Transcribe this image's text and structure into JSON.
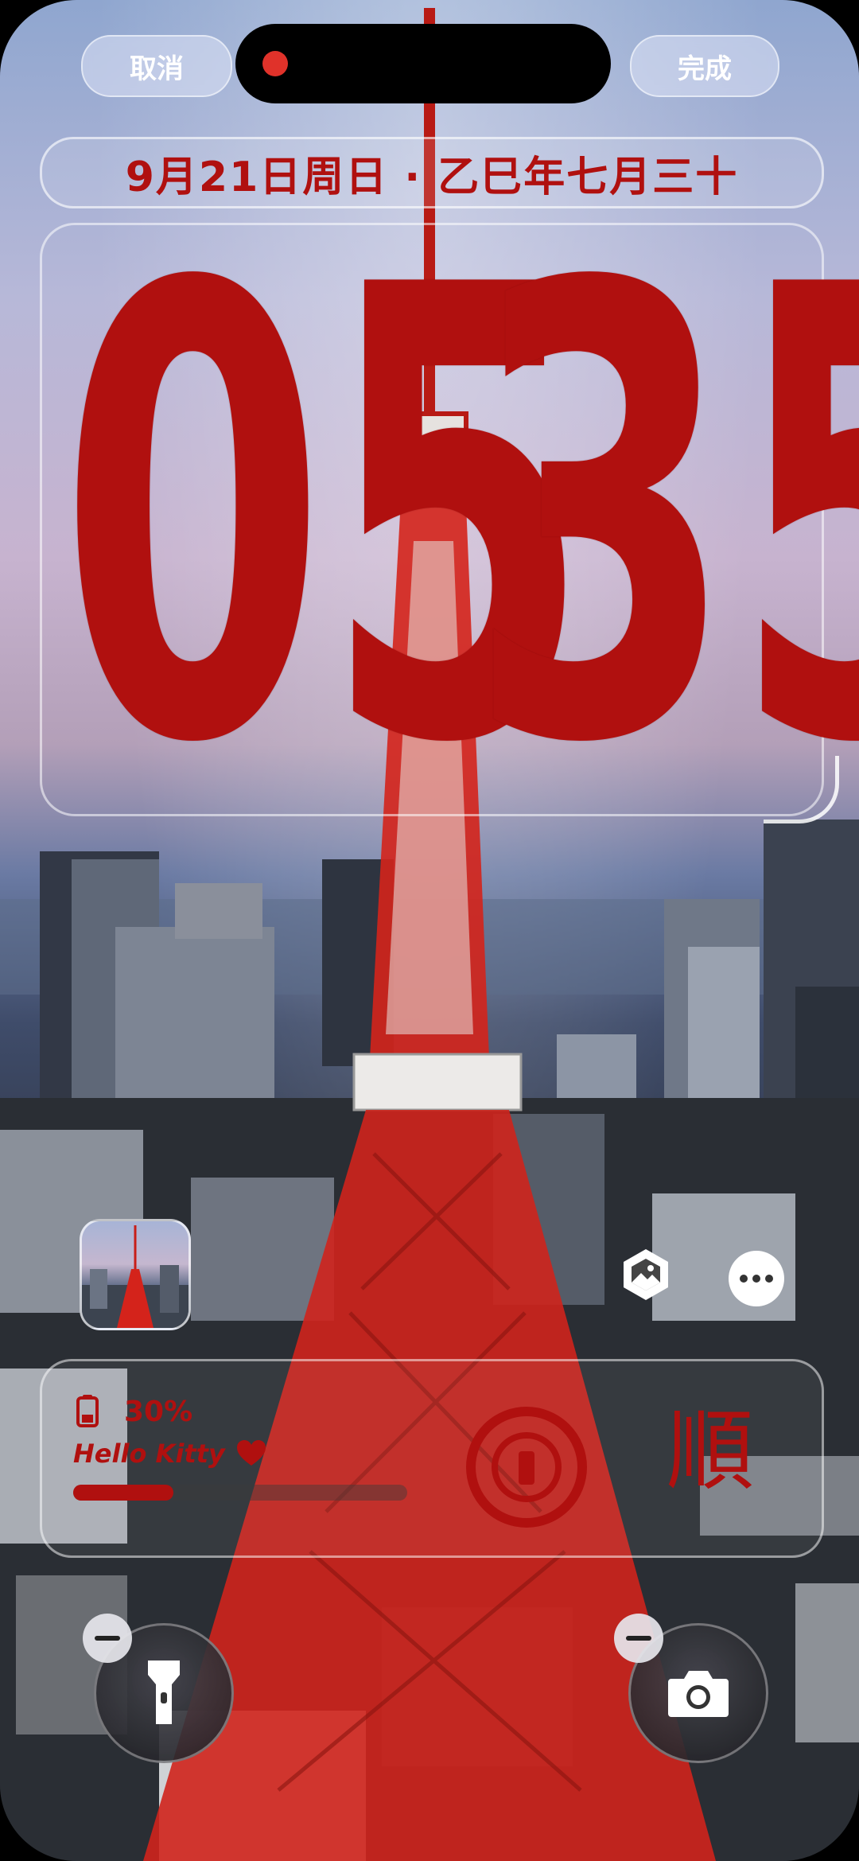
{
  "top_bar": {
    "cancel_label": "取消",
    "done_label": "完成"
  },
  "date_line": "9月21日周日 · 乙巳年七月三十",
  "clock": {
    "hours": "05",
    "minutes": "35"
  },
  "widget": {
    "battery_percent_label": "30%",
    "battery_level": 0.3,
    "caption": "Hello Kitty",
    "heart_icon": "heart-icon",
    "seal_char": "順",
    "accent_color": "#b0100f"
  },
  "controls": {
    "photo_icon": "photo-icon",
    "more_icon": "more-icon",
    "flashlight_icon": "flashlight-icon",
    "camera_icon": "camera-icon"
  },
  "colors": {
    "clock_red": "#b0100f",
    "tower_red": "#d4231b"
  }
}
